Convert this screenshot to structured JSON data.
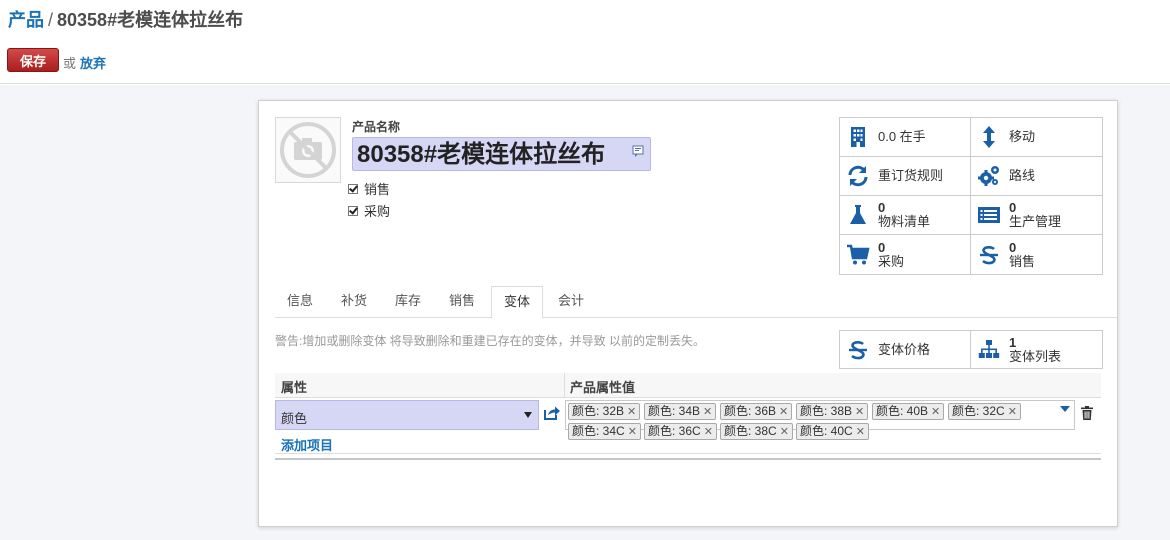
{
  "breadcrumb": {
    "parent": "产品",
    "separator": "/",
    "current": "80358#老模连体拉丝布"
  },
  "actions": {
    "save": "保存",
    "or": "或",
    "discard": "放弃"
  },
  "product": {
    "name_label": "产品名称",
    "name": "80358#老模连体拉丝布",
    "sale_ok": {
      "label": "销售",
      "checked": true
    },
    "purchase_ok": {
      "label": "采购",
      "checked": true
    }
  },
  "stats": [
    {
      "label": "0.0 在手",
      "icon": "building-icon"
    },
    {
      "label": "移动",
      "icon": "arrows-vertical-icon"
    },
    {
      "label": "重订货规则",
      "icon": "refresh-icon"
    },
    {
      "label": "路线",
      "icon": "gears-icon"
    },
    {
      "num": "0",
      "label": "物料清单",
      "icon": "flask-icon"
    },
    {
      "num": "0",
      "label": "生产管理",
      "icon": "list-icon"
    },
    {
      "num": "0",
      "label": "采购",
      "icon": "shopping-cart-icon"
    },
    {
      "num": "0",
      "label": "销售",
      "icon": "dollar-icon"
    }
  ],
  "tabs": [
    "信息",
    "补货",
    "库存",
    "销售",
    "变体",
    "会计"
  ],
  "active_tab": "变体",
  "warning": "警告:增加或删除变体 将导致删除和重建已存在的变体，并导致 以前的定制丢失。",
  "variant_buttons": [
    {
      "label": "变体价格",
      "icon": "dollar-icon"
    },
    {
      "num": "1",
      "label": "变体列表",
      "icon": "sitemap-icon"
    }
  ],
  "variants_table": {
    "headers": [
      "属性",
      "产品属性值"
    ],
    "row": {
      "attribute": "颜色",
      "values": [
        "颜色: 32B",
        "颜色: 34B",
        "颜色: 36B",
        "颜色: 38B",
        "颜色: 40B",
        "颜色: 32C",
        "颜色: 34C",
        "颜色: 36C",
        "颜色: 38C",
        "颜色: 40C"
      ]
    },
    "add_item": "添加项目"
  },
  "colors": {
    "link": "#1a73b7",
    "save": "#b52a2a",
    "selected_field": "#d6d7f5",
    "icon": "#1a5fa8"
  }
}
